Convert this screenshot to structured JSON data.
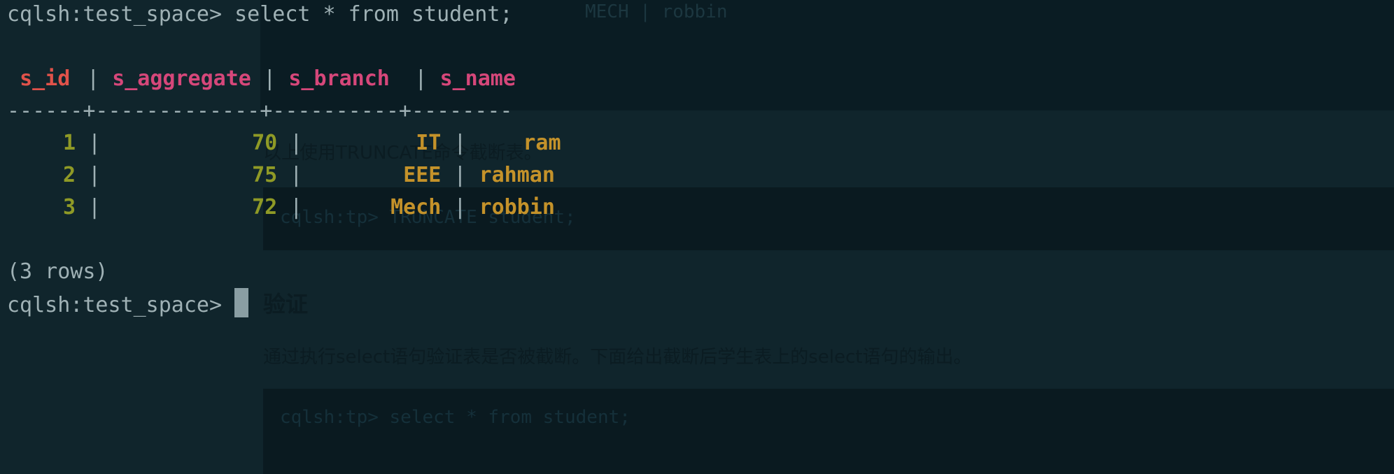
{
  "ghost_page": {
    "top_line": "MECH | robbin",
    "truncate_text": "以上使用TRUNCATE命令截断表。",
    "code1": "cqlsh:tp> TRUNCATE student;",
    "heading": "验证",
    "verify_text": "通过执行select语句验证表是否被截断。下面给出截断后学生表上的select语句的输出。",
    "code2": "cqlsh:tp> select * from student;"
  },
  "terminal": {
    "prompt": "cqlsh:test_space>",
    "command": "select * from student;",
    "headers": [
      "s_id",
      "s_aggregate",
      "s_branch",
      "s_name"
    ],
    "divider": "------+-------------+----------+--------",
    "rows": [
      {
        "s_id": "1",
        "s_aggregate": "70",
        "s_branch": "IT",
        "s_name": "ram"
      },
      {
        "s_id": "2",
        "s_aggregate": "75",
        "s_branch": "EEE",
        "s_name": "rahman"
      },
      {
        "s_id": "3",
        "s_aggregate": "72",
        "s_branch": "Mech",
        "s_name": "robbin"
      }
    ],
    "row_count": "(3 rows)",
    "prompt2": "cqlsh:test_space>"
  },
  "colors": {
    "background": "#10252c",
    "text": "#9fb1b5",
    "header_id": "#e0524a",
    "header": "#d6477a",
    "number": "#8f9a26",
    "value": "#c4922a",
    "cursor": "#8a9ea3"
  }
}
